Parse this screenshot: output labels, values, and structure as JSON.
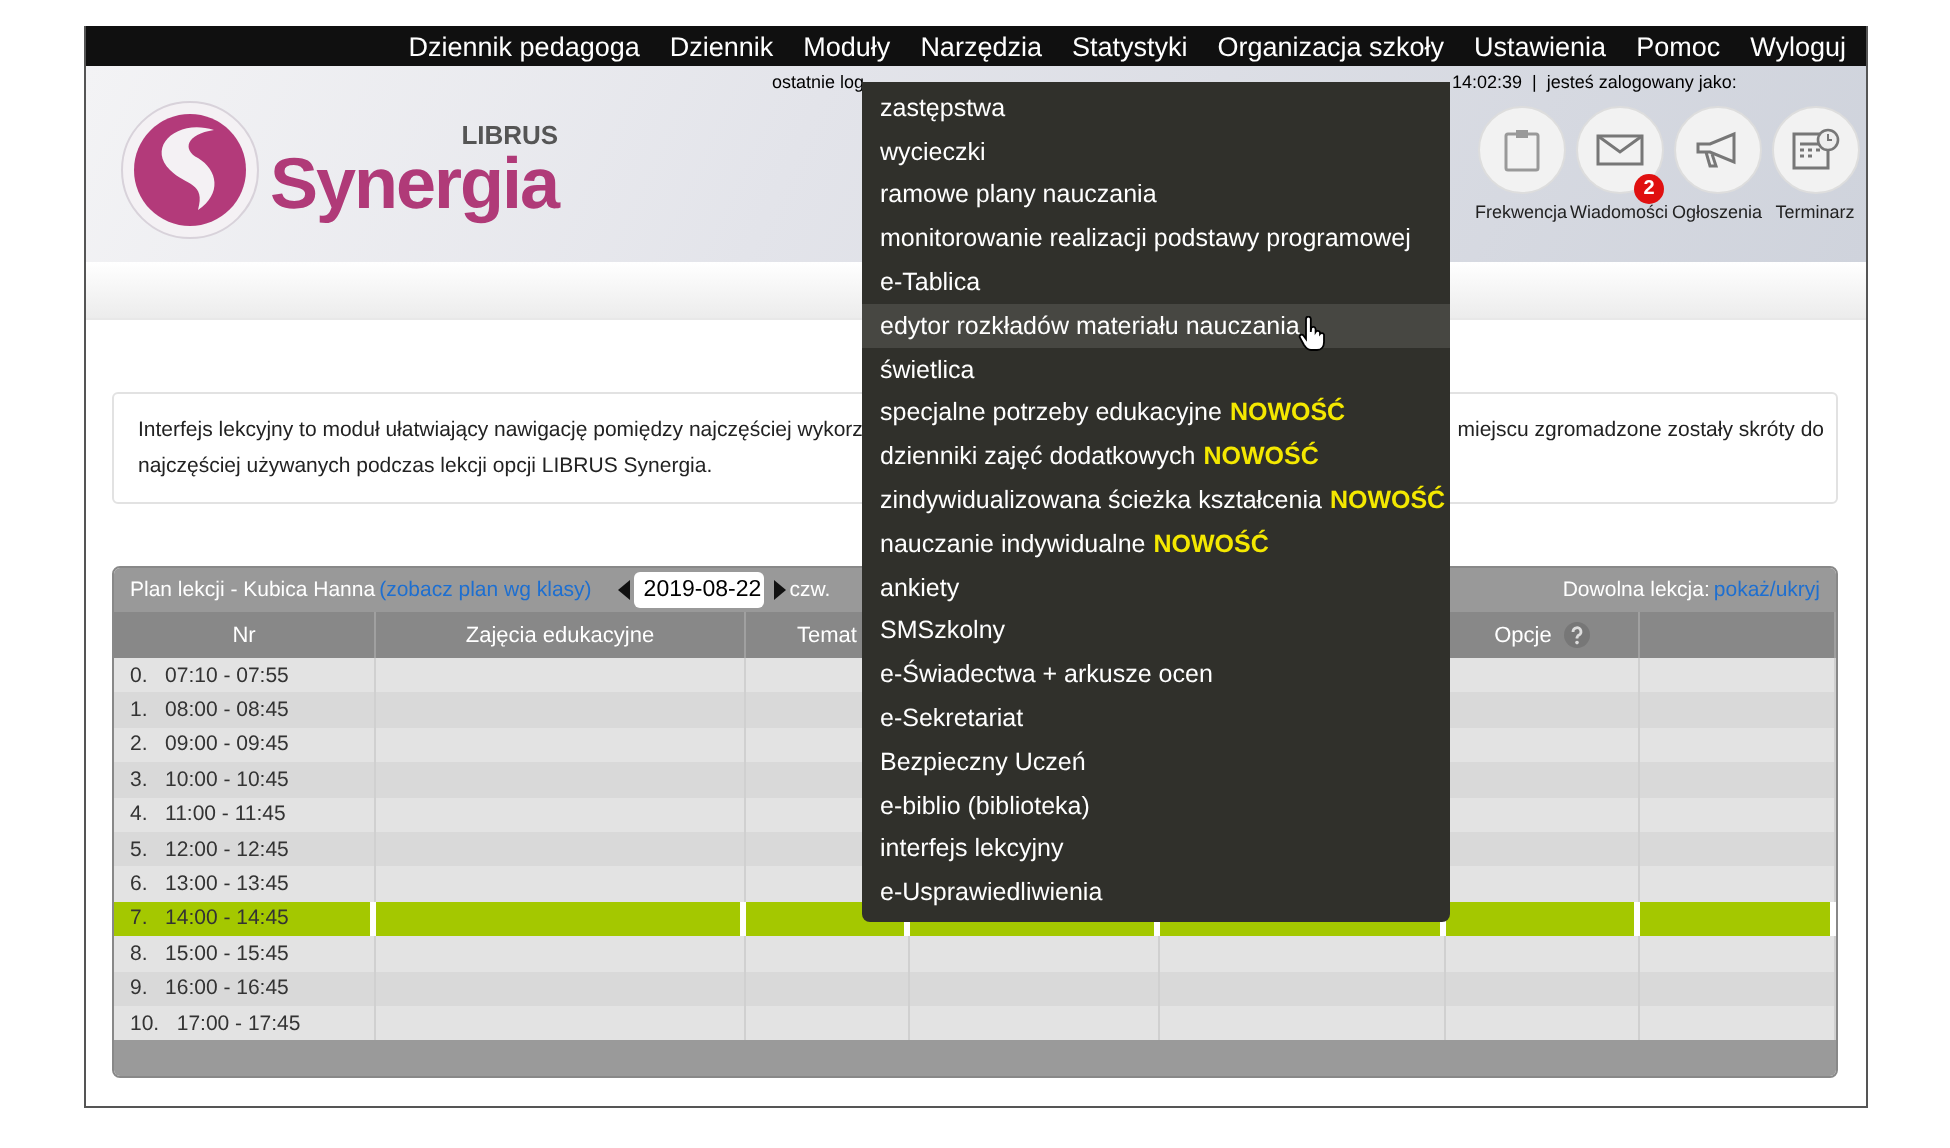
{
  "nav": [
    {
      "label": "Dziennik pedagoga"
    },
    {
      "label": "Dziennik"
    },
    {
      "label": "Moduły"
    },
    {
      "label": "Narzędzia"
    },
    {
      "label": "Statystyki"
    },
    {
      "label": "Organizacja szkoły"
    },
    {
      "label": "Ustawienia"
    },
    {
      "label": "Pomoc"
    },
    {
      "label": "Wyloguj"
    }
  ],
  "login_info": [
    "ostatnie log",
    "14:02:39  |  jesteś zalogowany jako:"
  ],
  "logo": {
    "brand": "LIBRUS",
    "name": "Synergia"
  },
  "shortcuts": [
    {
      "kind": "clipboard",
      "label": "Frekwencja"
    },
    {
      "kind": "mail",
      "label": "Wiadomości",
      "badge": "2"
    },
    {
      "kind": "megaphone",
      "label": "Ogłoszenia"
    },
    {
      "kind": "calendar",
      "label": "Terminarz"
    }
  ],
  "info_text": {
    "line_1_left": "Interfejs lekcyjny to moduł ułatwiający nawigację pomiędzy najczęściej wykorz",
    "line_1_right": "miejscu zgromadzone zostały skróty do",
    "line_2": "najczęściej używanych podczas lekcji opcji LIBRUS Synergia."
  },
  "plan": {
    "title": "Plan lekcji - Kubica Hanna",
    "class_link": "(zobacz plan wg klasy)",
    "date": "2019-08-22",
    "weekday": "czw.",
    "any_lesson_label": "Dowolna lekcja:",
    "any_lesson_link": "pokaż/ukryj",
    "columns": [
      {
        "kind": "number",
        "label": "Nr"
      },
      {
        "kind": "subject",
        "label": "Zajęcia edukacyjne"
      },
      {
        "kind": "topic",
        "label": "Temat"
      },
      {
        "kind": "options",
        "label": "Opcje"
      }
    ],
    "rows": [
      {
        "label": "0.   07:10 - 07:55",
        "selected": false
      },
      {
        "label": "1.   08:00 - 08:45",
        "selected": false
      },
      {
        "label": "2.   09:00 - 09:45",
        "selected": false
      },
      {
        "label": "3.   10:00 - 10:45",
        "selected": false
      },
      {
        "label": "4.   11:00 - 11:45",
        "selected": false
      },
      {
        "label": "5.   12:00 - 12:45",
        "selected": false
      },
      {
        "label": "6.   13:00 - 13:45",
        "selected": false
      },
      {
        "label": "7.   14:00 - 14:45",
        "selected": true
      },
      {
        "label": "8.   15:00 - 15:45",
        "selected": false
      },
      {
        "label": "9.   16:00 - 16:45",
        "selected": false
      },
      {
        "label": "10.   17:00 - 17:45",
        "selected": false
      }
    ]
  },
  "modules_menu": [
    {
      "label": "zastępstwa",
      "selected": false
    },
    {
      "label": "wycieczki",
      "selected": false
    },
    {
      "label": "ramowe plany nauczania",
      "selected": false
    },
    {
      "label": "monitorowanie realizacji podstawy programowej",
      "selected": false
    },
    {
      "label": "e-Tablica",
      "selected": false
    },
    {
      "label": "edytor rozkładów materiału nauczania",
      "selected": true
    },
    {
      "label": "świetlica",
      "selected": false
    },
    {
      "label": "specjalne potrzeby edukacyjne",
      "badge": "NOWOŚĆ",
      "selected": false
    },
    {
      "label": "dzienniki zajęć dodatkowych",
      "badge": "NOWOŚĆ",
      "selected": false
    },
    {
      "label": "zindywidualizowana ścieżka kształcenia",
      "badge": "NOWOŚĆ",
      "selected": false
    },
    {
      "label": "nauczanie indywidualne",
      "badge": "NOWOŚĆ",
      "selected": false
    },
    {
      "label": "ankiety",
      "selected": false
    },
    {
      "label": "SMSzkolny",
      "selected": false
    },
    {
      "label": "e-Świadectwa + arkusze ocen",
      "selected": false
    },
    {
      "label": "e-Sekretariat",
      "selected": false
    },
    {
      "label": "Bezpieczny Uczeń",
      "selected": false
    },
    {
      "label": "e-biblio (biblioteka)",
      "selected": false
    },
    {
      "label": "interfejs lekcyjny",
      "selected": false
    },
    {
      "label": "e-Usprawiedliwienia",
      "selected": false
    }
  ]
}
